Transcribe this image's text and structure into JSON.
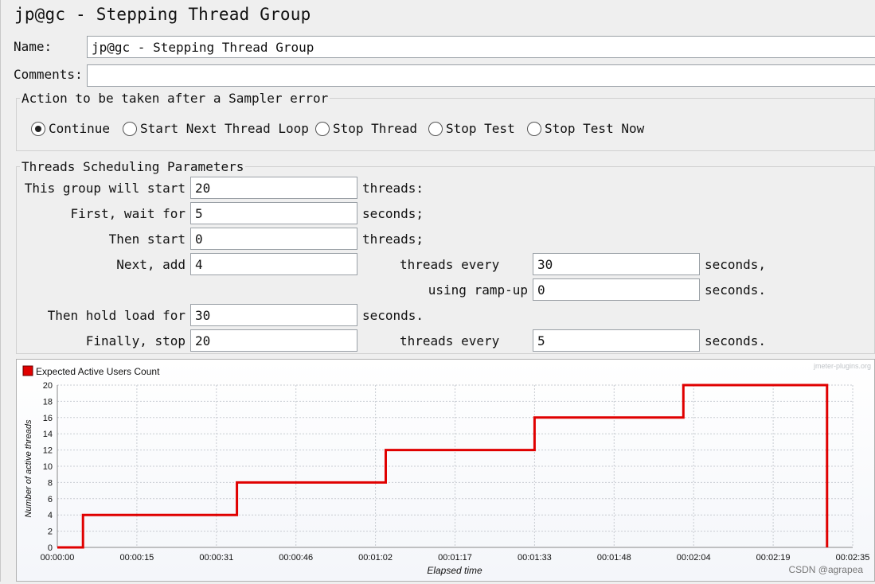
{
  "window": {
    "title": "jp@gc - Stepping Thread Group"
  },
  "form": {
    "name_label": "Name:",
    "name_value": "jp@gc - Stepping Thread Group",
    "comments_label": "Comments:",
    "comments_value": ""
  },
  "error_action": {
    "legend": "Action to be taken after a Sampler error",
    "options": [
      {
        "label": "Continue",
        "selected": true
      },
      {
        "label": "Start Next Thread Loop",
        "selected": false
      },
      {
        "label": "Stop Thread",
        "selected": false
      },
      {
        "label": "Stop Test",
        "selected": false
      },
      {
        "label": "Stop Test Now",
        "selected": false
      }
    ]
  },
  "scheduling": {
    "legend": "Threads Scheduling Parameters",
    "start_label": "This group will start",
    "start_value": "20",
    "start_unit": "threads:",
    "wait_label": "First, wait for",
    "wait_value": "5",
    "wait_unit": "seconds;",
    "then_start_label": "Then start",
    "then_start_value": "0",
    "then_start_unit": "threads;",
    "next_add_label": "Next, add",
    "next_add_value": "4",
    "threads_every_label": "threads every",
    "every_value": "30",
    "every_unit": "seconds,",
    "rampup_label": "using ramp-up",
    "rampup_value": "0",
    "rampup_unit": "seconds.",
    "hold_label": "Then hold load for",
    "hold_value": "30",
    "hold_unit": "seconds.",
    "stop_label": "Finally, stop",
    "stop_value": "20",
    "stop_threads_every_label": "threads every",
    "stop_every_value": "5",
    "stop_every_unit": "seconds."
  },
  "chart_data": {
    "type": "line",
    "legend": "Expected Active Users Count",
    "watermark": "jmeter-plugins.org",
    "credit": "CSDN @agrapea",
    "xlabel": "Elapsed time",
    "ylabel": "Number of active threads",
    "ylim": [
      0,
      20
    ],
    "xlim_seconds": [
      0,
      155
    ],
    "y_ticks": [
      "0",
      "2",
      "4",
      "6",
      "8",
      "10",
      "12",
      "14",
      "16",
      "18",
      "20"
    ],
    "x_ticks": [
      "00:00:00",
      "00:00:15",
      "00:00:31",
      "00:00:46",
      "00:01:02",
      "00:01:17",
      "00:01:33",
      "00:01:48",
      "00:02:04",
      "00:02:19",
      "00:02:35"
    ],
    "series_color": "#e00000",
    "grid": true,
    "series": [
      {
        "name": "Expected Active Users Count",
        "points": [
          [
            0,
            0
          ],
          [
            5,
            0
          ],
          [
            5,
            4
          ],
          [
            35,
            4
          ],
          [
            35,
            8
          ],
          [
            64,
            8
          ],
          [
            64,
            12
          ],
          [
            93,
            12
          ],
          [
            93,
            16
          ],
          [
            122,
            16
          ],
          [
            122,
            20
          ],
          [
            150,
            20
          ],
          [
            150,
            0
          ]
        ]
      }
    ]
  }
}
